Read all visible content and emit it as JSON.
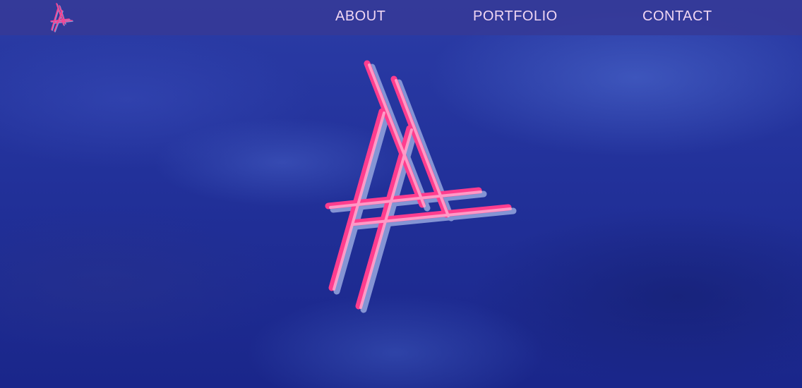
{
  "nav": {
    "about_label": "ABOUT",
    "portfolio_label": "PORTFOLIO",
    "contact_label": "CONTACT"
  },
  "icons": {
    "nav_logo": "monogram-a-logo-icon",
    "hero_logo": "monogram-a-hero-logo"
  },
  "colors": {
    "nav_background": "#363a96",
    "nav_text": "#f0d6f3",
    "logo_pink": "#ff3d8e",
    "logo_light": "#ffaad0",
    "logo_shadow": "#8a9ad8",
    "sky_blue": "#22319a"
  }
}
